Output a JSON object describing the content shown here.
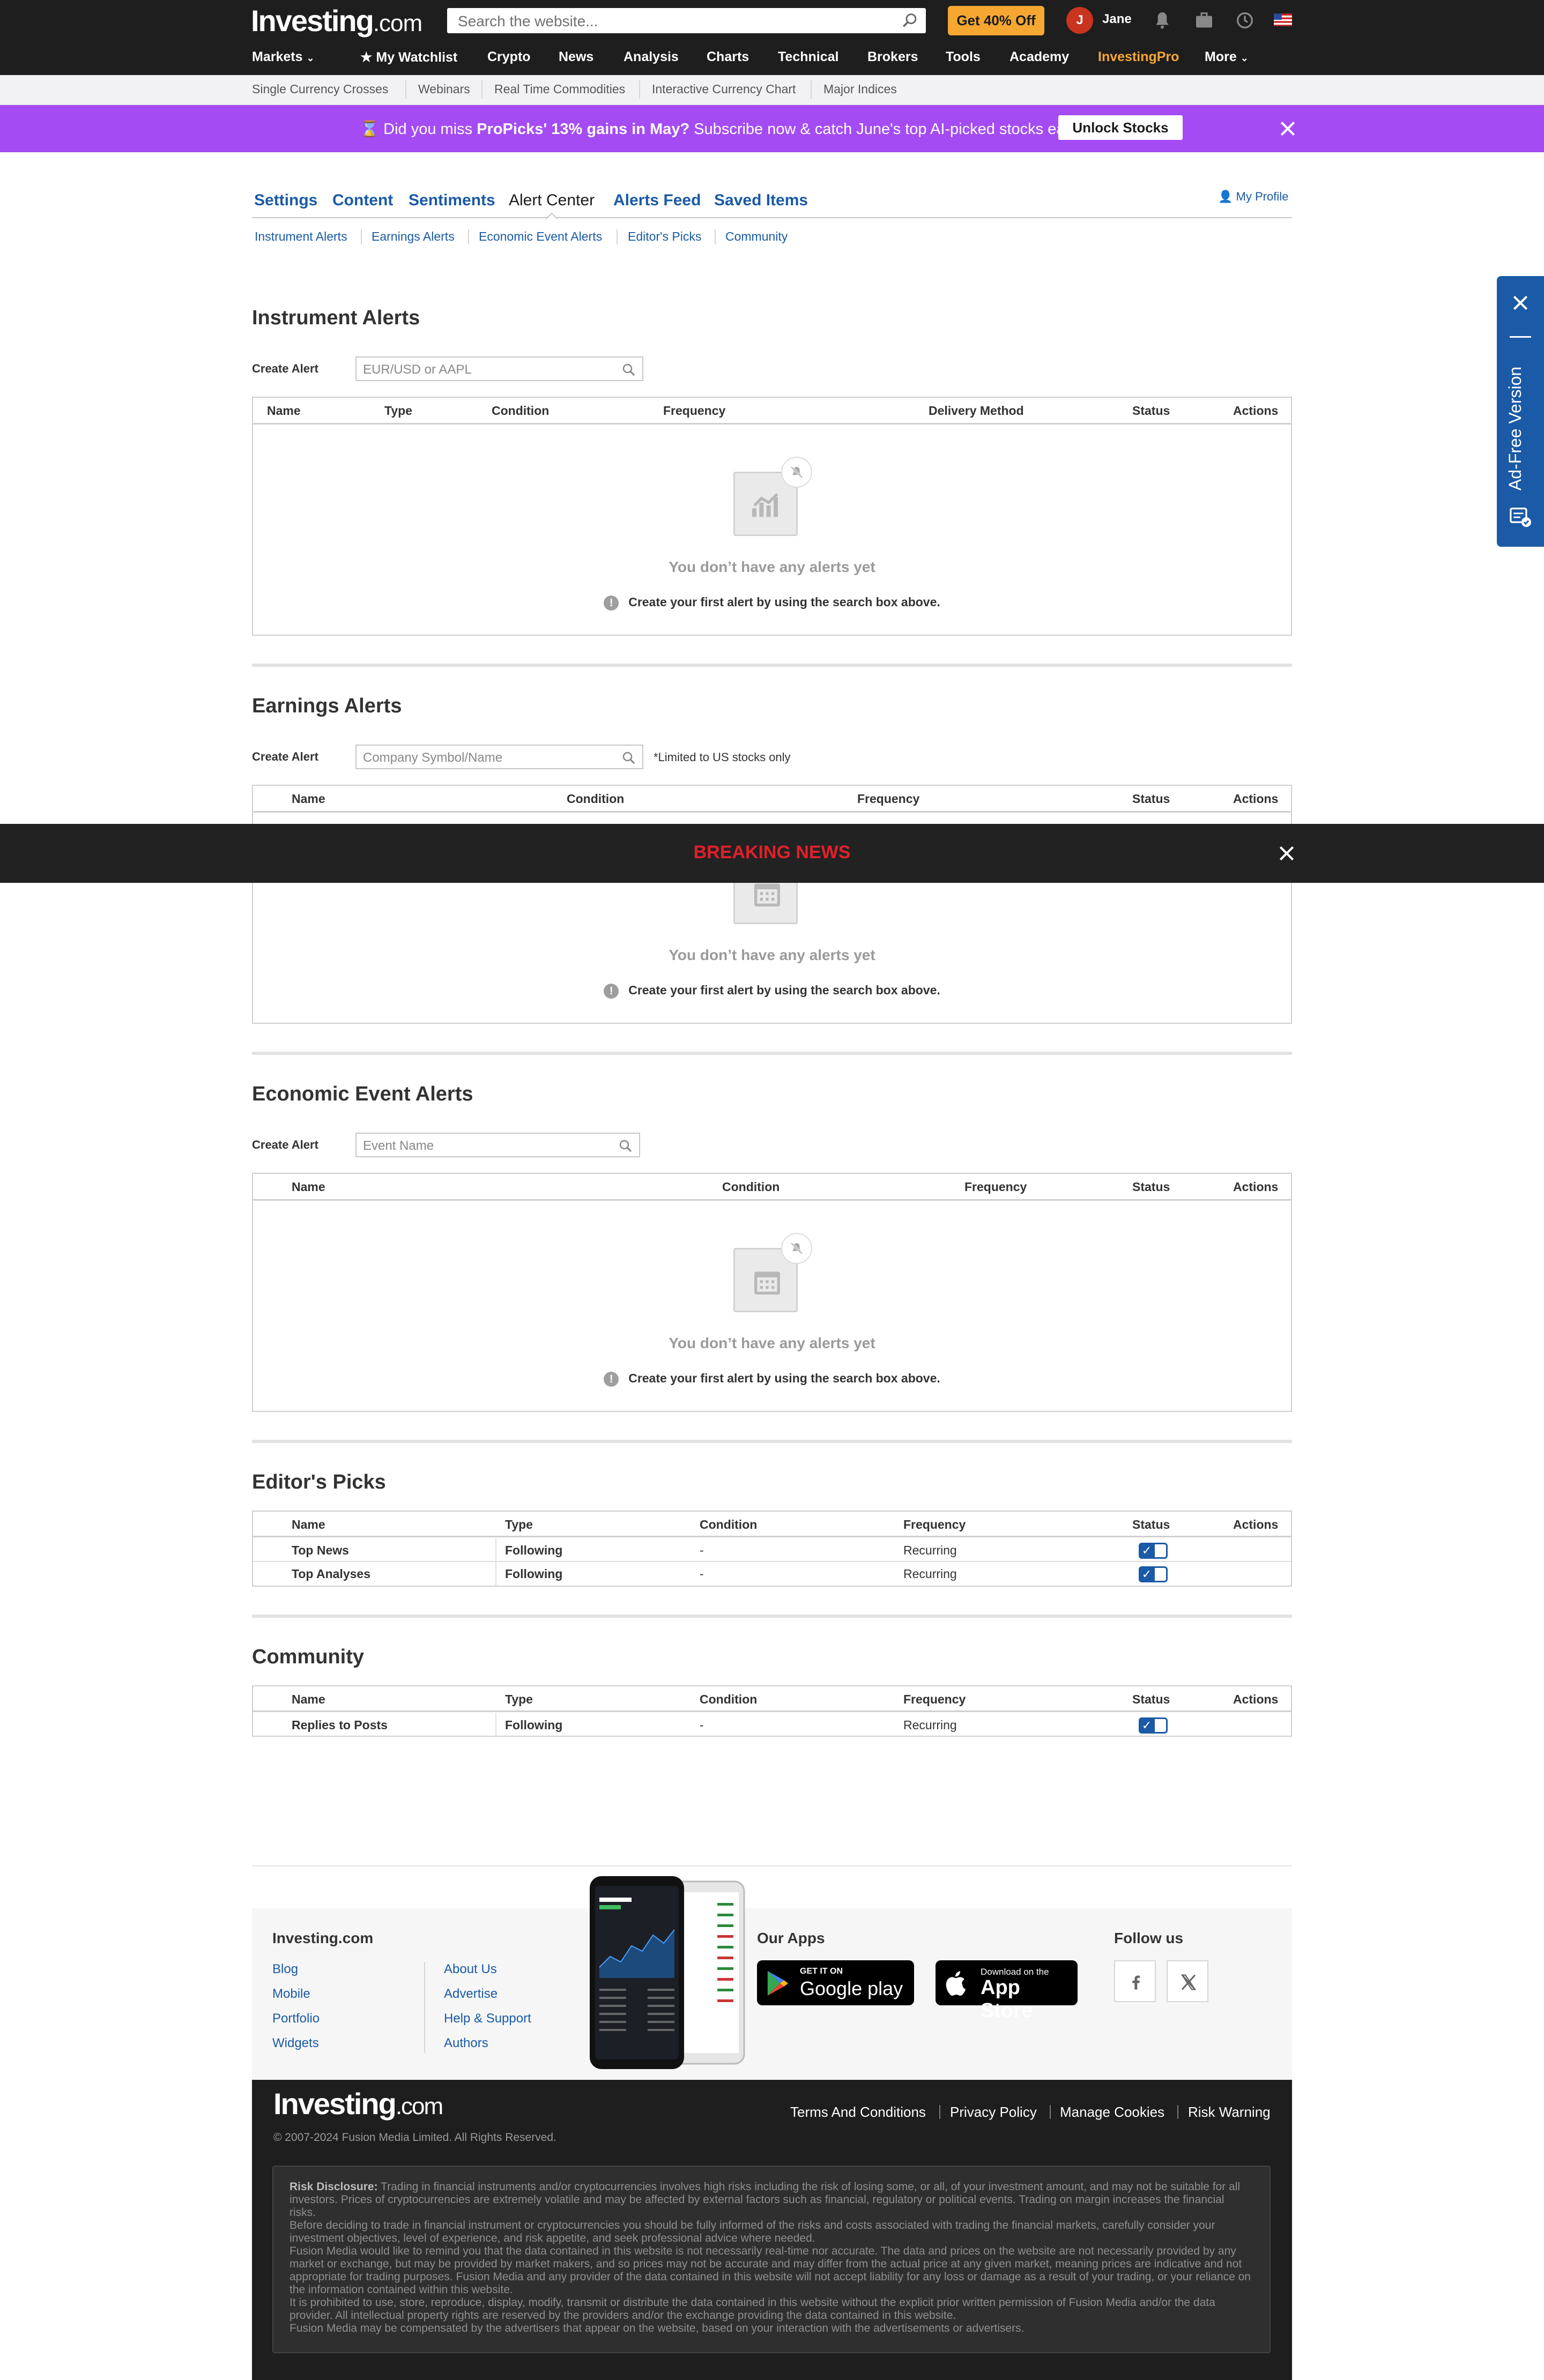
{
  "header": {
    "logo_main": "Investing",
    "logo_suffix": ".com",
    "search_placeholder": "Search the website...",
    "promo_button": "Get 40% Off",
    "avatar_initial": "J",
    "user_name": "Jane"
  },
  "nav": {
    "items": [
      "Markets",
      "My Watchlist",
      "Crypto",
      "News",
      "Analysis",
      "Charts",
      "Technical",
      "Brokers",
      "Tools",
      "Academy",
      "InvestingPro",
      "More"
    ]
  },
  "subnav": {
    "items": [
      "Single Currency Crosses",
      "Webinars",
      "Real Time Commodities",
      "Interactive Currency Chart",
      "Major Indices"
    ]
  },
  "promo_banner": {
    "lead": "Did you miss ",
    "highlight": "ProPicks' 13% gains in May?",
    "tail": " Subscribe now & catch June's top AI-picked stocks early.",
    "button": "Unlock Stocks"
  },
  "profile_tabs": {
    "tabs": [
      "Settings",
      "Content",
      "Sentiments",
      "Alert Center",
      "Alerts Feed",
      "Saved Items"
    ],
    "active": "Alert Center",
    "my_profile": "My Profile",
    "sub_tabs": [
      "Instrument Alerts",
      "Earnings Alerts",
      "Economic Event Alerts",
      "Editor's Picks",
      "Community"
    ]
  },
  "create_alert_label": "Create Alert",
  "empty_state": {
    "title": "You don’t have any alerts yet",
    "hint": "Create your first alert by using the search box above."
  },
  "instrument_alerts": {
    "title": "Instrument Alerts",
    "placeholder": "EUR/USD or AAPL",
    "columns": [
      "Name",
      "Type",
      "Condition",
      "Frequency",
      "Delivery Method",
      "Status",
      "Actions"
    ]
  },
  "earnings_alerts": {
    "title": "Earnings Alerts",
    "placeholder": "Company Symbol/Name",
    "note": "*Limited to US stocks only",
    "columns": [
      "Name",
      "Condition",
      "Frequency",
      "Status",
      "Actions"
    ]
  },
  "economic_alerts": {
    "title": "Economic Event Alerts",
    "placeholder": "Event Name",
    "columns": [
      "Name",
      "Condition",
      "Frequency",
      "Status",
      "Actions"
    ]
  },
  "editors_picks": {
    "title": "Editor's Picks",
    "columns": [
      "Name",
      "Type",
      "Condition",
      "Frequency",
      "Status",
      "Actions"
    ],
    "rows": [
      {
        "name": "Top News",
        "type": "Following",
        "condition": "-",
        "frequency": "Recurring",
        "status": true
      },
      {
        "name": "Top Analyses",
        "type": "Following",
        "condition": "-",
        "frequency": "Recurring",
        "status": true
      }
    ]
  },
  "community": {
    "title": "Community",
    "columns": [
      "Name",
      "Type",
      "Condition",
      "Frequency",
      "Status",
      "Actions"
    ],
    "rows": [
      {
        "name": "Replies to Posts",
        "type": "Following",
        "condition": "-",
        "frequency": "Recurring",
        "status": true
      }
    ]
  },
  "breaking_news": "BREAKING NEWS",
  "ad_free": "Ad-Free Version",
  "footer": {
    "site_heading": "Investing.com",
    "links_col1": [
      "Blog",
      "Mobile",
      "Portfolio",
      "Widgets"
    ],
    "links_col2": [
      "About Us",
      "Advertise",
      "Help & Support",
      "Authors"
    ],
    "apps_heading": "Our Apps",
    "google_small": "GET IT ON",
    "google_big": "Google play",
    "apple_small": "Download on the",
    "apple_big": "App Store",
    "follow_heading": "Follow us",
    "legal_links": [
      "Terms And Conditions",
      "Privacy Policy",
      "Manage Cookies",
      "Risk Warning"
    ],
    "copyright": "© 2007-2024 Fusion Media Limited. All Rights Reserved.",
    "risk_label": "Risk Disclosure:",
    "risk_p1": "Trading in financial instruments and/or cryptocurrencies involves high risks including the risk of losing some, or all, of your investment amount, and may not be suitable for all investors. Prices of cryptocurrencies are extremely volatile and may be affected by external factors such as financial, regulatory or political events. Trading on margin increases the financial risks.",
    "risk_p2": "Before deciding to trade in financial instrument or cryptocurrencies you should be fully informed of the risks and costs associated with trading the financial markets, carefully consider your investment objectives, level of experience, and risk appetite, and seek professional advice where needed.",
    "risk_p3": "Fusion Media would like to remind you that the data contained in this website is not necessarily real-time nor accurate. The data and prices on the website are not necessarily provided by any market or exchange, but may be provided by market makers, and so prices may not be accurate and may differ from the actual price at any given market, meaning prices are indicative and not appropriate for trading purposes. Fusion Media and any provider of the data contained in this website will not accept liability for any loss or damage as a result of your trading, or your reliance on the information contained within this website.",
    "risk_p4": "It is prohibited to use, store, reproduce, display, modify, transmit or distribute the data contained in this website without the explicit prior written permission of Fusion Media and/or the data provider. All intellectual property rights are reserved by the providers and/or the exchange providing the data contained in this website.",
    "risk_p5": "Fusion Media may be compensated by the advertisers that appear on the website, based on your interaction with the advertisements or advertisers."
  }
}
